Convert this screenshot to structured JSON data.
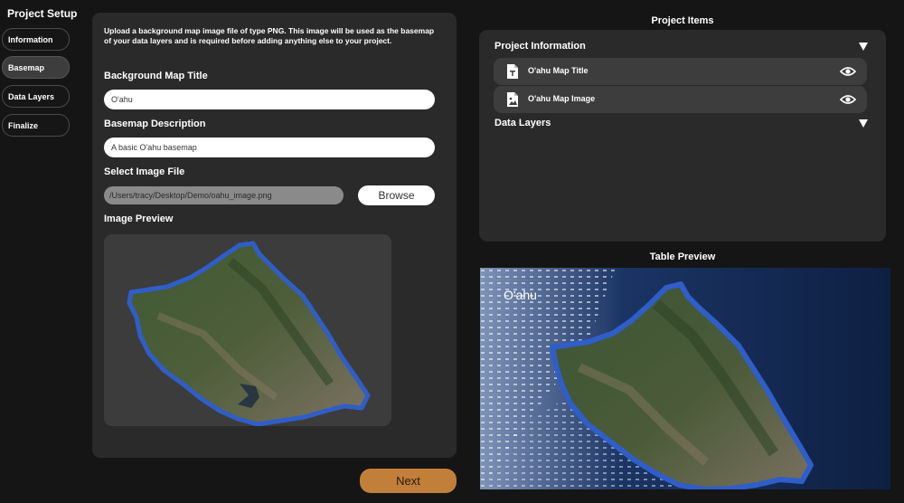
{
  "sidebar": {
    "title": "Project Setup",
    "items": [
      {
        "label": "Information"
      },
      {
        "label": "Basemap"
      },
      {
        "label": "Data Layers"
      },
      {
        "label": "Finalize"
      }
    ]
  },
  "main": {
    "intro": "Upload a background map image file of type PNG. This image will be used as the basemap of your data layers and is required before adding anything else to your project.",
    "title_label": "Background Map Title",
    "title_value": "O'ahu",
    "description_label": "Basemap Description",
    "description_value": "A basic O'ahu basemap",
    "file_label": "Select Image File",
    "file_path": "/Users/tracy/Desktop/Demo/oahu_image.png",
    "browse_label": "Browse",
    "preview_label": "Image Preview",
    "next_label": "Next"
  },
  "project_items": {
    "title": "Project Items",
    "sections": [
      {
        "label": "Project Information"
      },
      {
        "label": "Data Layers"
      }
    ],
    "items": [
      {
        "label": "O'ahu Map Title",
        "icon": "text-file-icon"
      },
      {
        "label": "O'ahu Map Image",
        "icon": "image-file-icon"
      }
    ]
  },
  "table_preview": {
    "title": "Table Preview",
    "map_title": "O'ahu"
  },
  "colors": {
    "background": "#151515",
    "panel": "#2a2a2a",
    "accent": "#c17f3a",
    "ocean": "#0f2243"
  }
}
